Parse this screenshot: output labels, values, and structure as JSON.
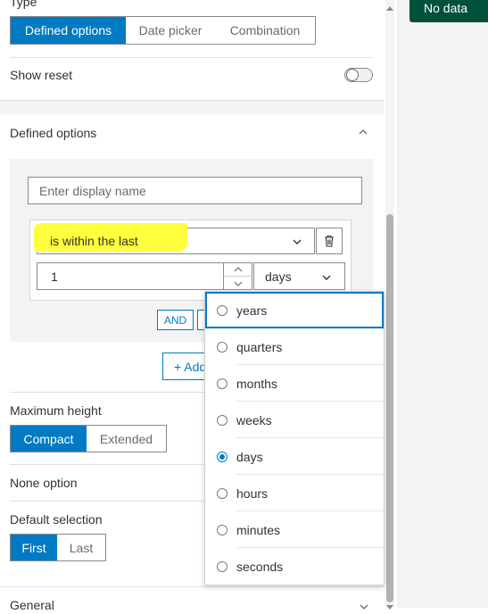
{
  "type": {
    "label": "Type",
    "options": [
      "Defined options",
      "Date picker",
      "Combination"
    ],
    "selected": "Defined options"
  },
  "show_reset": {
    "label": "Show reset",
    "enabled": false
  },
  "defined_options": {
    "title": "Defined options",
    "display_name_placeholder": "Enter display name",
    "operator": "is within the last",
    "number_value": "1",
    "unit_value": "days",
    "and_label": "AND",
    "add_label": "+ Add"
  },
  "unit_dropdown": {
    "options": [
      "years",
      "quarters",
      "months",
      "weeks",
      "days",
      "hours",
      "minutes",
      "seconds"
    ],
    "selected": "days",
    "focused": "years"
  },
  "maximum_height": {
    "label": "Maximum height",
    "options": [
      "Compact",
      "Extended"
    ],
    "selected": "Compact"
  },
  "none_option": {
    "label": "None option"
  },
  "default_selection": {
    "label": "Default selection",
    "options": [
      "First",
      "Last"
    ],
    "selected": "First"
  },
  "general": {
    "title": "General"
  },
  "preview": {
    "no_data_label": "No data"
  },
  "colors": {
    "accent": "#007ac2",
    "highlight": "#ffff33",
    "preview_green": "#00513a"
  }
}
